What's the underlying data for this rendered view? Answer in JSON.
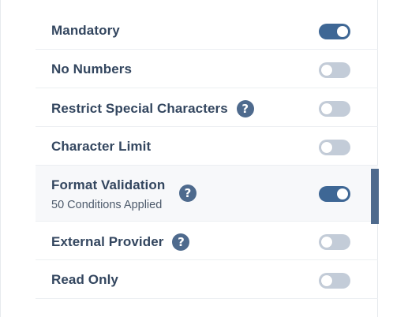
{
  "settings": {
    "rows": [
      {
        "label": "Mandatory",
        "enabled": true
      },
      {
        "label": "No Numbers",
        "enabled": false
      },
      {
        "label": "Restrict Special Characters",
        "enabled": false,
        "help_icon": "help-circle-icon"
      },
      {
        "label": "Character Limit",
        "enabled": false
      },
      {
        "label": "Format Validation",
        "sublabel": "50 Conditions Applied",
        "enabled": true,
        "help_icon": "help-circle-icon"
      },
      {
        "label": "External Provider",
        "enabled": false,
        "help_icon": "help-circle-icon"
      },
      {
        "label": "Read Only",
        "enabled": false
      }
    ],
    "help_glyph": "?"
  },
  "colors": {
    "toggle_on": "#3e6795",
    "toggle_off": "#c3ccd8",
    "help_icon": "#4e6a8d",
    "label_text": "#33465f",
    "scrollbar_thumb": "#4e6a8d"
  }
}
